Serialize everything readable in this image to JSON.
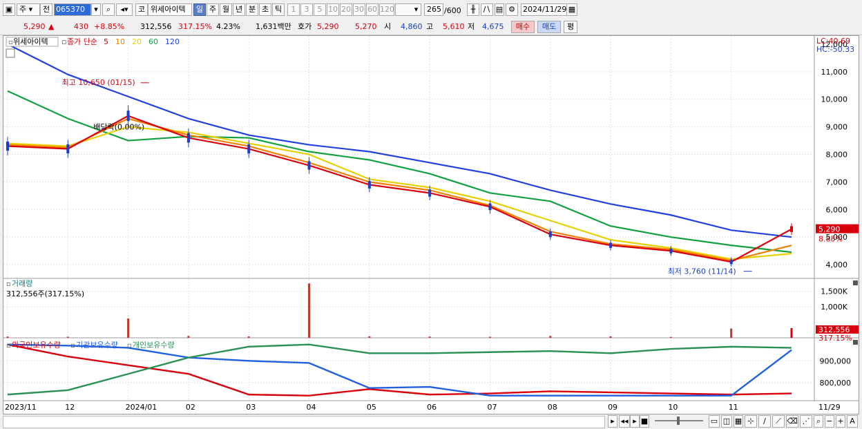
{
  "toolbar": {
    "mode": "주",
    "prev_label": "전",
    "code": "065370",
    "name_prefix": "코",
    "stock_name": "위세아이텍",
    "periods": [
      "일",
      "주",
      "월",
      "년",
      "분",
      "초",
      "틱"
    ],
    "active_period": "일",
    "intervals": [
      "1",
      "3",
      "5",
      "10",
      "20",
      "30",
      "60",
      "120"
    ],
    "count_display": "265",
    "count_max": "/600",
    "date": "2024/11/29"
  },
  "quote": {
    "price": "5,290",
    "change": "430",
    "change_pct": "+8.85%",
    "volume": "312,556",
    "volume_ratio": "317.15%",
    "turnover": "4.23%",
    "amount": "1,631백만",
    "bid_label": "호가",
    "bid": "5,290",
    "ask": "5,270",
    "open_label": "시",
    "open": "4,860",
    "high_label": "고",
    "high": "5,610",
    "low_label": "저",
    "low": "4,675",
    "buy_button": "매수",
    "sell_button": "매도",
    "eval_button": "평"
  },
  "price_pane": {
    "stock_label": "위세아이텍",
    "ma_label": "종가 단순",
    "ma_periods": [
      "5",
      "10",
      "20",
      "60",
      "120"
    ],
    "ma_colors": [
      "#d8000c",
      "#f08000",
      "#e8d000",
      "#10a040",
      "#2040e0"
    ],
    "lc_label": "LC:40.69",
    "hc_label": "HC:-50.33",
    "high_annotation": "최고 10,650 (01/15)",
    "low_annotation": "최저 3,760 (11/14)",
    "dividend_annotation": "배당락(0.00%)",
    "current_price_tag": "5,290",
    "current_pct_tag": "8.85%",
    "y_ticks": [
      "4,000",
      "5,000",
      "6,000",
      "7,000",
      "8,000",
      "9,000",
      "10,000",
      "11,000"
    ],
    "y_top_tick_partial": "12,000"
  },
  "volume_pane": {
    "title": "거래량",
    "info": "312,556주(317.15%)",
    "y_ticks": [
      "1,000K",
      "1,500K"
    ],
    "tag_value": "312,556",
    "tag_pct": "317.15%"
  },
  "holders_pane": {
    "legend": [
      "외국인보유수량",
      "기관보유수량",
      "개인보유수량"
    ],
    "y_ticks": [
      "800,000",
      "900,000"
    ]
  },
  "x_axis": {
    "labels": [
      "2023/11",
      "12",
      "2024/01",
      "02",
      "03",
      "04",
      "05",
      "06",
      "07",
      "08",
      "09",
      "10",
      "11"
    ],
    "end_label": "11/29"
  },
  "chart_data": [
    {
      "type": "line",
      "title": "위세아이텍 종가 단순",
      "x": [
        "2023-11",
        "2023-12",
        "2024-01",
        "2024-02",
        "2024-03",
        "2024-04",
        "2024-05",
        "2024-06",
        "2024-07",
        "2024-08",
        "2024-09",
        "2024-10",
        "2024-11",
        "2024-11-29"
      ],
      "ylim": [
        3500,
        12300
      ],
      "series": [
        {
          "name": "5",
          "values": [
            8300,
            8200,
            9400,
            8600,
            8200,
            7600,
            6900,
            6600,
            6100,
            5100,
            4700,
            4500,
            4100,
            5290
          ]
        },
        {
          "name": "10",
          "values": [
            8350,
            8250,
            9300,
            8700,
            8300,
            7700,
            7000,
            6700,
            6150,
            5200,
            4750,
            4550,
            4150,
            4700
          ]
        },
        {
          "name": "20",
          "values": [
            8400,
            8300,
            9000,
            8800,
            8400,
            8000,
            7100,
            6800,
            6300,
            5600,
            4900,
            4600,
            4200,
            4400
          ]
        },
        {
          "name": "60",
          "values": [
            10300,
            9300,
            8500,
            8650,
            8600,
            8100,
            7800,
            7300,
            6600,
            6300,
            5400,
            5000,
            4700,
            4450
          ]
        },
        {
          "name": "120",
          "values": [
            12000,
            10900,
            10100,
            9300,
            8700,
            8350,
            8100,
            7700,
            7300,
            6700,
            6200,
            5800,
            5250,
            5000
          ]
        }
      ],
      "annotations": {
        "high": [
          "2024-01-15",
          10650
        ],
        "low": [
          "2024-11-14",
          3760
        ],
        "last": 5290
      }
    },
    {
      "type": "bar",
      "title": "거래량",
      "categories": [
        "2023-11",
        "2023-12",
        "2024-01",
        "2024-02",
        "2024-03",
        "2024-04",
        "2024-05",
        "2024-06",
        "2024-07",
        "2024-08",
        "2024-09",
        "2024-10",
        "2024-11",
        "2024-11-29"
      ],
      "values": [
        40000,
        35000,
        620000,
        60000,
        45000,
        1750000,
        50000,
        40000,
        35000,
        60000,
        50000,
        30000,
        300000,
        312556
      ],
      "ylim": [
        0,
        1800000
      ]
    },
    {
      "type": "line",
      "title": "보유수량",
      "x": [
        "2023-11",
        "2023-12",
        "2024-01",
        "2024-02",
        "2024-03",
        "2024-04",
        "2024-05",
        "2024-06",
        "2024-07",
        "2024-08",
        "2024-09",
        "2024-10",
        "2024-11",
        "2024-11-29"
      ],
      "ylim": [
        720000,
        990000
      ],
      "series": [
        {
          "name": "외국인보유수량",
          "values": [
            975000,
            920000,
            880000,
            840000,
            745000,
            740000,
            770000,
            745000,
            750000,
            760000,
            755000,
            750000,
            745000,
            750000
          ]
        },
        {
          "name": "기관보유수량",
          "values": [
            975000,
            970000,
            960000,
            915000,
            900000,
            890000,
            775000,
            780000,
            740000,
            740000,
            740000,
            740000,
            740000,
            950000
          ]
        },
        {
          "name": "개인보유수량",
          "values": [
            745000,
            765000,
            840000,
            915000,
            965000,
            975000,
            935000,
            935000,
            940000,
            945000,
            935000,
            955000,
            965000,
            960000
          ]
        }
      ]
    }
  ]
}
